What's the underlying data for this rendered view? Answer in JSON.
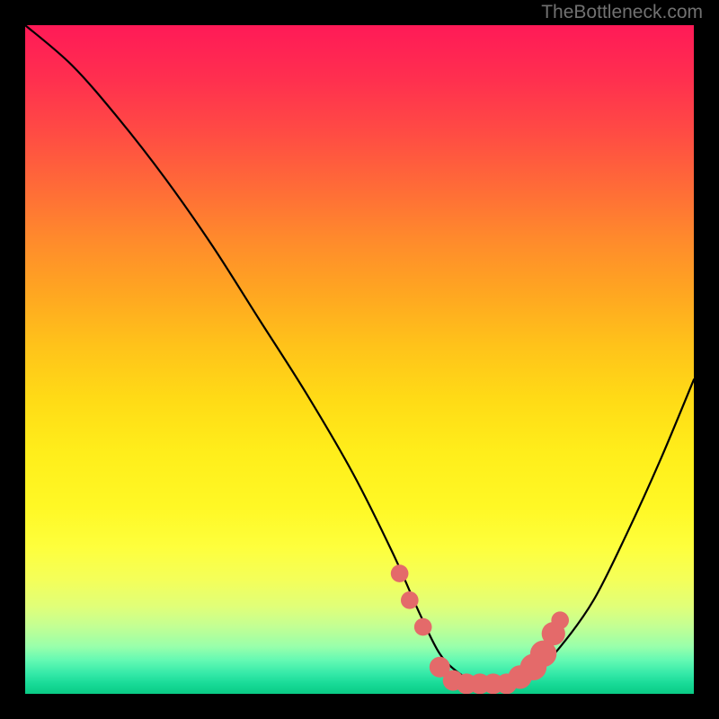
{
  "attribution": "TheBottleneck.com",
  "chart_data": {
    "type": "line",
    "title": "",
    "xlabel": "",
    "ylabel": "",
    "xlim": [
      0,
      100
    ],
    "ylim": [
      0,
      100
    ],
    "series": [
      {
        "name": "bottleneck-curve",
        "x": [
          0,
          7,
          14,
          21,
          28,
          35,
          42,
          49,
          55,
          59,
          62,
          65,
          68,
          72,
          76,
          80,
          85,
          90,
          95,
          100
        ],
        "y": [
          100,
          94,
          86,
          77,
          67,
          56,
          45,
          33,
          21,
          12,
          6,
          3,
          1.5,
          1.5,
          3,
          7,
          14,
          24,
          35,
          47
        ]
      }
    ],
    "markers": {
      "name": "highlighted-range",
      "points": [
        {
          "x": 56,
          "y": 18,
          "r": 1.2
        },
        {
          "x": 57.5,
          "y": 14,
          "r": 1.2
        },
        {
          "x": 59.5,
          "y": 10,
          "r": 1.2
        },
        {
          "x": 62,
          "y": 4,
          "r": 1.4
        },
        {
          "x": 64,
          "y": 2,
          "r": 1.4
        },
        {
          "x": 66,
          "y": 1.5,
          "r": 1.4
        },
        {
          "x": 68,
          "y": 1.5,
          "r": 1.4
        },
        {
          "x": 70,
          "y": 1.5,
          "r": 1.4
        },
        {
          "x": 72,
          "y": 1.5,
          "r": 1.4
        },
        {
          "x": 74,
          "y": 2.5,
          "r": 1.6
        },
        {
          "x": 76,
          "y": 4,
          "r": 1.8
        },
        {
          "x": 77.5,
          "y": 6,
          "r": 1.8
        },
        {
          "x": 79,
          "y": 9,
          "r": 1.6
        },
        {
          "x": 80,
          "y": 11,
          "r": 1.2
        }
      ]
    },
    "colors": {
      "curve": "#000000",
      "marker": "#e46a6a",
      "gradient_top": "#ff1a57",
      "gradient_bottom": "#0acb85"
    }
  }
}
